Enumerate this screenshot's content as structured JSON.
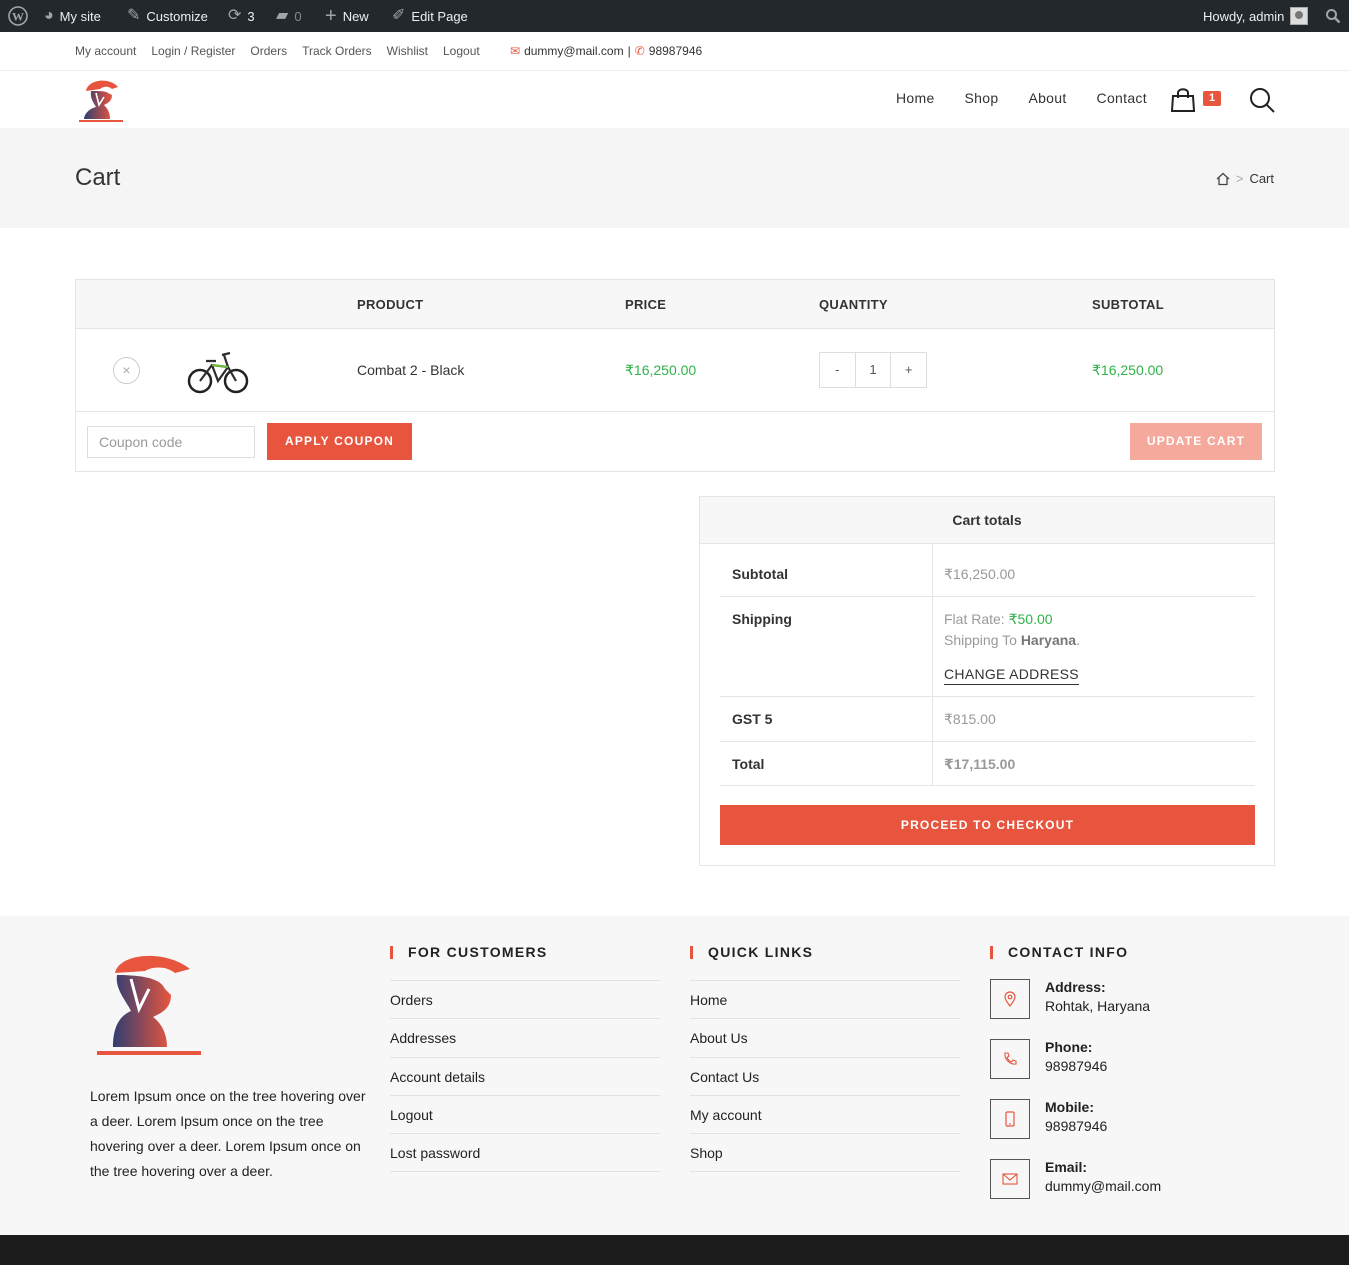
{
  "adminbar": {
    "my_site": "My site",
    "customize": "Customize",
    "updates": "3",
    "comments": "0",
    "new": "New",
    "edit_page": "Edit Page",
    "howdy": "Howdy, admin"
  },
  "topbar": {
    "links": [
      "My account",
      "Login / Register",
      "Orders",
      "Track Orders",
      "Wishlist",
      "Logout"
    ],
    "email": "dummy@mail.com",
    "sep": "|",
    "phone": "98987946"
  },
  "nav": [
    "Home",
    "Shop",
    "About",
    "Contact"
  ],
  "cart_count": "1",
  "page": {
    "title": "Cart",
    "breadcrumb_current": "Cart"
  },
  "cart_table": {
    "headers": {
      "product": "PRODUCT",
      "price": "PRICE",
      "quantity": "QUANTITY",
      "subtotal": "SUBTOTAL"
    },
    "item": {
      "remove": "×",
      "name": "Combat 2 - Black",
      "price": "₹16,250.00",
      "qty_minus": "-",
      "qty": "1",
      "qty_plus": "+",
      "subtotal": "₹16,250.00"
    },
    "coupon_placeholder": "Coupon code",
    "apply_label": "APPLY COUPON",
    "update_label": "UPDATE CART"
  },
  "totals": {
    "title": "Cart totals",
    "subtotal_label": "Subtotal",
    "subtotal_value": "₹16,250.00",
    "shipping_label": "Shipping",
    "flat_rate_label": "Flat Rate:",
    "flat_rate_value": "₹50.00",
    "shipping_to_label": "Shipping To",
    "shipping_to_value": "Haryana",
    "change_address": "CHANGE ADDRESS",
    "gst_label": "GST 5",
    "gst_value": "₹815.00",
    "total_label": "Total",
    "total_value": "₹17,115.00",
    "checkout_label": "PROCEED TO CHECKOUT"
  },
  "footer": {
    "about": "Lorem Ipsum once on the tree hovering over a deer. Lorem Ipsum once on the tree hovering over a deer. Lorem Ipsum once on the tree hovering over a deer.",
    "customers_title": "FOR CUSTOMERS",
    "customers_links": [
      "Orders",
      "Addresses",
      "Account details",
      "Logout",
      "Lost password"
    ],
    "quick_title": "QUICK LINKS",
    "quick_links": [
      "Home",
      "About Us",
      "Contact Us",
      "My account",
      "Shop"
    ],
    "contact_title": "CONTACT INFO",
    "address_label": "Address:",
    "address_value": "Rohtak, Haryana",
    "phone_label": "Phone:",
    "phone_value": "98987946",
    "mobile_label": "Mobile:",
    "mobile_value": "98987946",
    "email_label": "Email:",
    "email_value": "dummy@mail.com"
  },
  "colors": {
    "accent": "#e8553e",
    "price_green": "#2fb24a",
    "admin_bar": "#23282d"
  }
}
